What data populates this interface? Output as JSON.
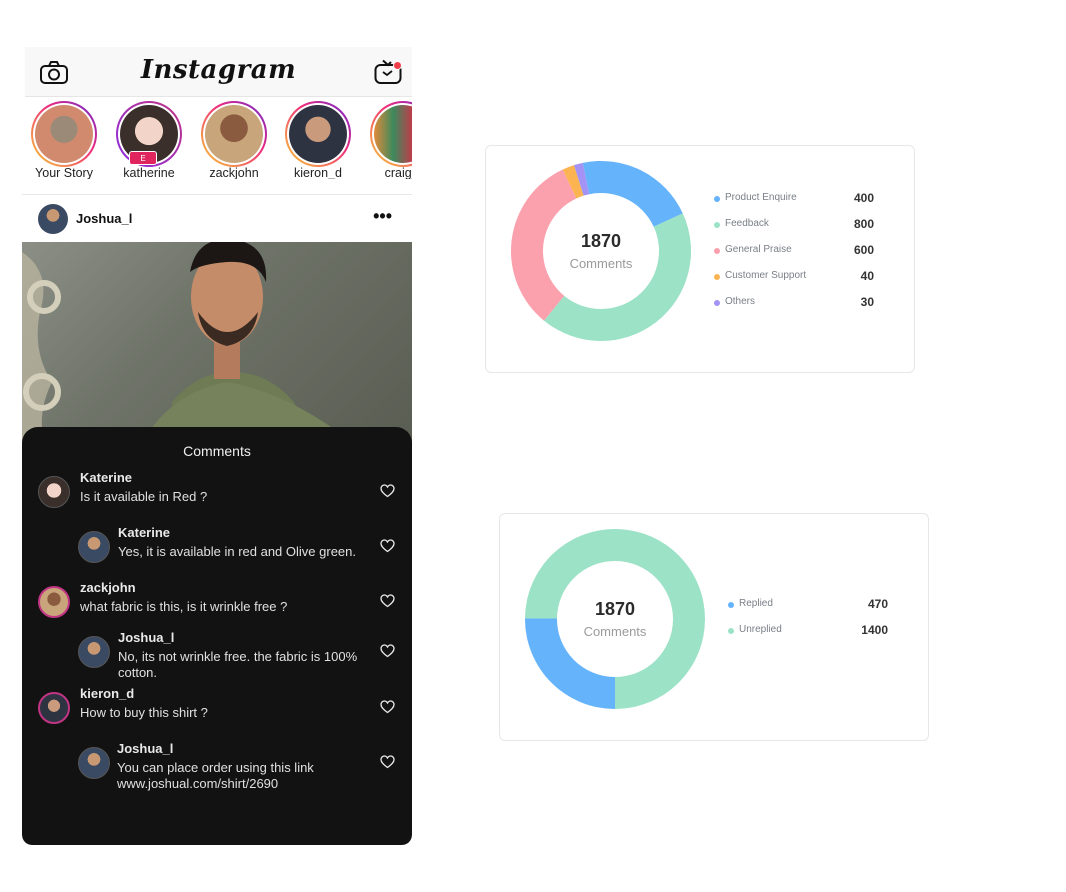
{
  "app": {
    "title": "Instagram",
    "colors": {
      "accent": "#e0245e",
      "notification": "#ef3e4a",
      "comments_bg": "#121212"
    }
  },
  "stories": [
    {
      "name": "Your Story"
    },
    {
      "name": "katherine",
      "badge": "E"
    },
    {
      "name": "zackjohn"
    },
    {
      "name": "kieron_d"
    },
    {
      "name": "craig_l"
    }
  ],
  "post": {
    "author": "Joshua_l",
    "more_icon": "more-horizontal-icon"
  },
  "comments": {
    "title": "Comments",
    "items": [
      {
        "name": "Katerine",
        "text": "Is it available in Red ?"
      },
      {
        "name": "Katerine",
        "text": "Yes, it is available in red and  Olive green."
      },
      {
        "name": "zackjohn",
        "text": "what fabric is this, is it wrinkle free ?"
      },
      {
        "name": "Joshua_l",
        "text": "No, its not wrinkle free. the fabric is 100% cotton."
      },
      {
        "name": "kieron_d",
        "text": "How to buy this shirt ?"
      },
      {
        "name": "Joshua_l",
        "text": "You can place order using this link www.joshual.com/shirt/2690"
      }
    ]
  },
  "chart_data": [
    {
      "type": "pie",
      "center_value": "1870",
      "center_label": "Comments",
      "categories": [
        "Product Enquire",
        "Feedback",
        "General Praise",
        "Customer Support",
        "Others"
      ],
      "values": [
        400,
        800,
        600,
        40,
        30
      ],
      "colors": [
        "#65b3fb",
        "#9be2c6",
        "#fba0ad",
        "#fbb451",
        "#a393f4"
      ]
    },
    {
      "type": "pie",
      "center_value": "1870",
      "center_label": "Comments",
      "categories": [
        "Replied",
        "Unreplied"
      ],
      "values": [
        470,
        1400
      ],
      "colors": [
        "#65b3fb",
        "#9be2c6"
      ]
    }
  ]
}
